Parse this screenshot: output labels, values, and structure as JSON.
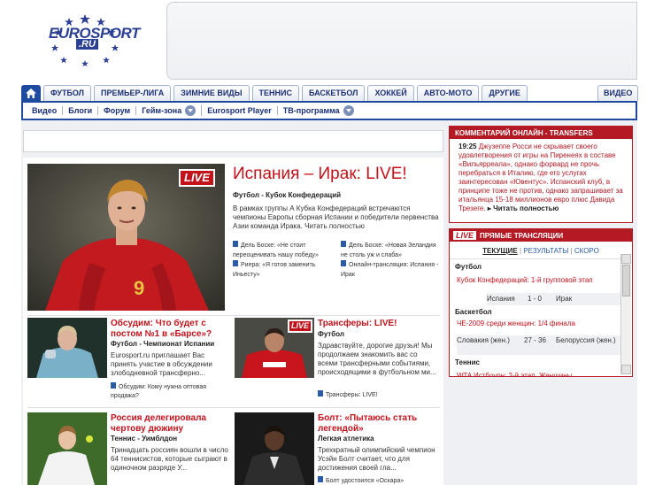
{
  "header": {
    "logo_text": "EUROSPORT",
    "logo_sub": ".RU"
  },
  "nav": {
    "tabs": [
      "ФУТБОЛ",
      "ПРЕМЬЕР-ЛИГА",
      "ЗИМНИЕ ВИДЫ",
      "ТЕННИС",
      "БАСКЕТБОЛ",
      "ХОККЕЙ",
      "АВТО-МОТО",
      "ДРУГИЕ"
    ],
    "video_tab": "ВИДЕО",
    "sub_items": [
      "Видео",
      "Блоги",
      "Форум",
      "Гейм-зона",
      "Eurosport Player",
      "ТВ-программа"
    ]
  },
  "hero": {
    "live_label": "LIVE",
    "title": "Испания – Ирак: LIVE!",
    "subtitle": "Футбол - Кубок Конфедераций",
    "text": "В рамках группы А Кубка Конфедераций встречаются чемпионы Европы сборная Испании и победители первенства Азии команда Ирака.",
    "more": "Читать полностью",
    "links": [
      "Дель Боске: «Не стоит переоценивать нашу победу»",
      "Дель Боске: «Новая Зеландия не столь уж и слаба»",
      "Риера: «Я готов заменить Иньесту»",
      "Онлайн-трансляция: Испания - Ирак"
    ]
  },
  "cards": [
    {
      "title": "Обсудим: Что будет с постом №1 в «Барсе»?",
      "category": "Футбол - Чемпионат Испании",
      "text": "Eurosport.ru приглашает Вас принять участие в обсуждении злободневной трансферно...",
      "link": "Обсудим: Кому нужна оптовая продажа?"
    },
    {
      "title": "Трансферы: LIVE!",
      "category": "Футбол",
      "text": "Здравствуйте, дорогие друзья! Мы продолжаем знакомить вас со всеми трансферными событиями, происходящими в футбольном ми...",
      "link": "Трансферы: LIVE!",
      "live_label": "LIVE"
    },
    {
      "title": "Россия делегировала чертову дюжину",
      "category": "Теннис - Уимблдон",
      "text": "Тринадцать россиян вошли в число 64 теннисистов, которые сыграют в одиночном разряде У...",
      "link": ""
    },
    {
      "title": "Болт: «Пытаюсь стать легендой»",
      "category": "Легкая атлетика",
      "text": "Трехкратный олимпийский чемпион Усэйн Болт считает, что для достижения своей гла...",
      "link": "Болт удостоился «Оскара»"
    }
  ],
  "commentary": {
    "header": "КОММЕНТАРИЙ ОНЛАЙН - TRANSFERS",
    "time": "19:25",
    "text": "Джузеппе Росси не скрывает своего удовлетворения от игры на Пиренеях в составе «Вильярреала», однако форвард не прочь перебраться в Италию, где его услугах заинтересован «Ювентус». Испанский клуб, в принципе тоже не против, однако запрашивает за итальянца 15-18 миллионов евро плюс Давида Трезеге.",
    "more": "Читать полностью"
  },
  "live_panel": {
    "badge": "LIVE",
    "header": "ПРЯМЫЕ ТРАНСЛЯЦИИ",
    "tabs": [
      "ТЕКУЩИЕ",
      "РЕЗУЛЬТАТЫ",
      "СКОРО"
    ],
    "sports": [
      {
        "sport": "Футбол",
        "competition": "Кубок Конфедераций: 1-й групповой этап",
        "home": "Испания",
        "score": "1 - 0",
        "away": "Ирак"
      },
      {
        "sport": "Баскетбол",
        "competition": "ЧЕ-2009 среди женщин: 1/4 финала",
        "home": "Словакия (жен.)",
        "score": "27 - 36",
        "away": "Белоруссия (жен.)"
      },
      {
        "sport": "Теннис",
        "competition": "WTA Истбоурн: 2-й этап, Женщины",
        "home": "",
        "score": "",
        "away": ""
      }
    ]
  }
}
